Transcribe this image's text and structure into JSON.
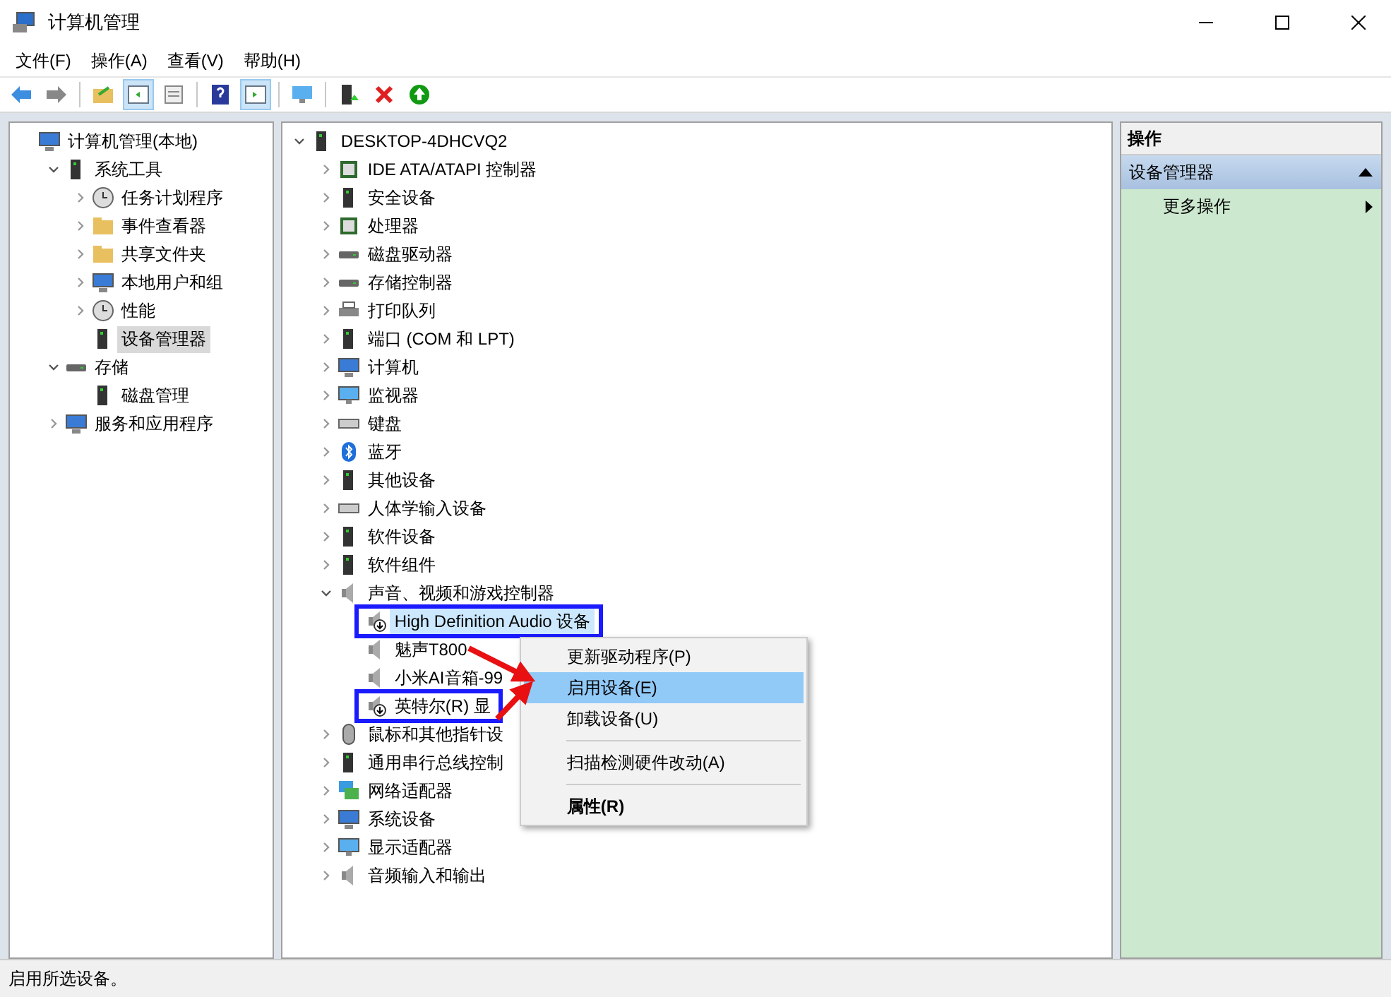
{
  "window": {
    "title": "计算机管理"
  },
  "menu": [
    "文件(F)",
    "操作(A)",
    "查看(V)",
    "帮助(H)"
  ],
  "toolbar": [
    {
      "pressed": false
    },
    {
      "pressed": false
    },
    {
      "pressed": false
    },
    {
      "pressed": true
    },
    {
      "pressed": false
    },
    {
      "pressed": false
    },
    {
      "pressed": true
    },
    {
      "pressed": false
    },
    {
      "pressed": false
    },
    {
      "pressed": false
    },
    {
      "pressed": false
    }
  ],
  "console_tree": [
    {
      "label": "计算机管理(本地)",
      "selected": false,
      "children": [
        {
          "label": "系统工具",
          "expanded": true,
          "selected": false,
          "children": [
            {
              "label": "任务计划程序",
              "expanded": false,
              "selected": false
            },
            {
              "label": "事件查看器",
              "expanded": false,
              "selected": false
            },
            {
              "label": "共享文件夹",
              "expanded": false,
              "selected": false
            },
            {
              "label": "本地用户和组",
              "expanded": false,
              "selected": false
            },
            {
              "label": "性能",
              "expanded": false,
              "selected": false
            },
            {
              "label": "设备管理器",
              "selected": true
            }
          ]
        },
        {
          "label": "存储",
          "expanded": true,
          "selected": false,
          "children": [
            {
              "label": "磁盘管理",
              "selected": false
            }
          ]
        },
        {
          "label": "服务和应用程序",
          "expanded": false,
          "selected": false
        }
      ]
    }
  ],
  "device_tree": {
    "label": "DESKTOP-4DHCVQ2",
    "expanded": true,
    "children": [
      {
        "label": "IDE ATA/ATAPI 控制器",
        "expanded": false
      },
      {
        "label": "安全设备",
        "expanded": false
      },
      {
        "label": "处理器",
        "expanded": false
      },
      {
        "label": "磁盘驱动器",
        "expanded": false
      },
      {
        "label": "存储控制器",
        "expanded": false
      },
      {
        "label": "打印队列",
        "expanded": false
      },
      {
        "label": "端口 (COM 和 LPT)",
        "expanded": false
      },
      {
        "label": "计算机",
        "expanded": false
      },
      {
        "label": "监视器",
        "expanded": false
      },
      {
        "label": "键盘",
        "expanded": false
      },
      {
        "label": "蓝牙",
        "expanded": false
      },
      {
        "label": "其他设备",
        "expanded": false
      },
      {
        "label": "人体学输入设备",
        "expanded": false
      },
      {
        "label": "软件设备",
        "expanded": false
      },
      {
        "label": "软件组件",
        "expanded": false
      },
      {
        "label": "声音、视频和游戏控制器",
        "expanded": true,
        "children": [
          {
            "label": "High Definition Audio 设备",
            "disabled": true,
            "selected": true,
            "highlighted": true
          },
          {
            "label": "魅声T800",
            "disabled": false,
            "selected": false,
            "highlighted": false
          },
          {
            "label": "小米AI音箱-99",
            "disabled": false,
            "selected": false,
            "highlighted": false
          },
          {
            "label": "英特尔(R) 显",
            "disabled": true,
            "selected": false,
            "highlighted": true
          }
        ]
      },
      {
        "label": "鼠标和其他指针设",
        "expanded": false
      },
      {
        "label": "通用串行总线控制",
        "expanded": false
      },
      {
        "label": "网络适配器",
        "expanded": false
      },
      {
        "label": "系统设备",
        "expanded": false
      },
      {
        "label": "显示适配器",
        "expanded": false
      },
      {
        "label": "音频输入和输出",
        "expanded": false
      }
    ]
  },
  "context_menu": [
    {
      "kind": "item",
      "label": "更新驱动程序(P)",
      "selected": false,
      "default": false
    },
    {
      "kind": "item",
      "label": "启用设备(E)",
      "selected": true,
      "default": false
    },
    {
      "kind": "item",
      "label": "卸载设备(U)",
      "selected": false,
      "default": false
    },
    {
      "kind": "separator"
    },
    {
      "kind": "item",
      "label": "扫描检测硬件改动(A)",
      "selected": false,
      "default": false
    },
    {
      "kind": "separator"
    },
    {
      "kind": "item",
      "label": "属性(R)",
      "selected": false,
      "default": true
    }
  ],
  "actions": {
    "title": "操作",
    "section": {
      "label": "设备管理器",
      "expanded": true,
      "items": [
        "更多操作"
      ]
    }
  },
  "status_bar": "启用所选设备。"
}
